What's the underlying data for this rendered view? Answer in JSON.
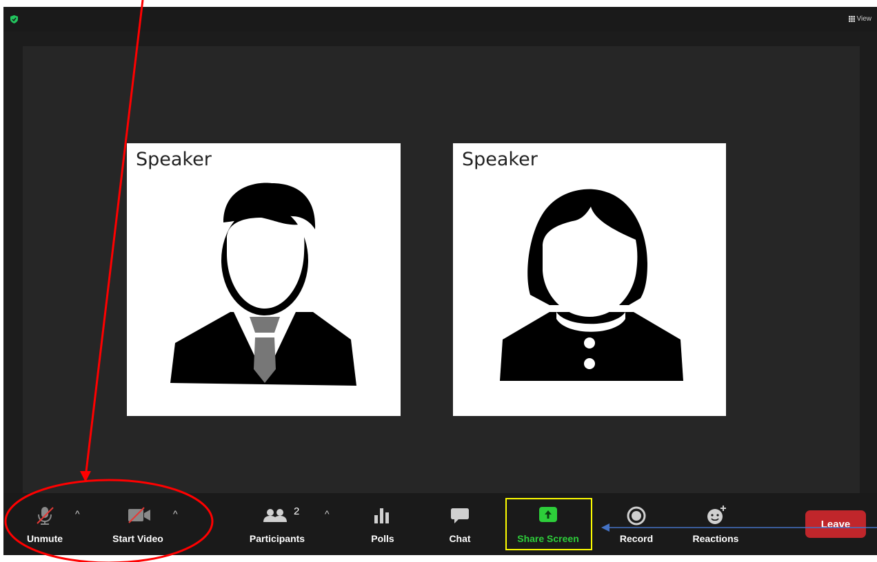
{
  "header": {
    "view_label": "View",
    "security_icon": "shield-check-icon",
    "view_icon": "grid-icon"
  },
  "tiles": [
    {
      "label": "Speaker",
      "avatar": "man-avatar"
    },
    {
      "label": "Speaker",
      "avatar": "woman-avatar"
    }
  ],
  "toolbar": {
    "unmute_label": "Unmute",
    "start_video_label": "Start Video",
    "participants_label": "Participants",
    "participants_count": "2",
    "polls_label": "Polls",
    "chat_label": "Chat",
    "share_screen_label": "Share Screen",
    "record_label": "Record",
    "reactions_label": "Reactions",
    "leave_label": "Leave",
    "caret": "^"
  },
  "colors": {
    "share_screen_green": "#2dce3a",
    "leave_red": "#c0262b",
    "annotation_red": "#ff0000",
    "annotation_yellow": "#ffff00",
    "annotation_blue": "#4472c4"
  }
}
